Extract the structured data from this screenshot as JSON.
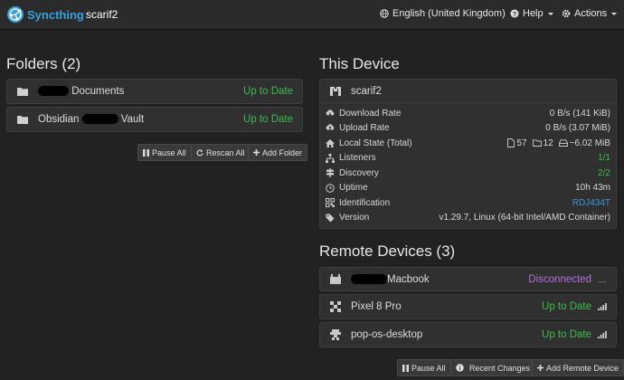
{
  "navbar": {
    "brand": "Syncthing",
    "device_name": "scarif2",
    "language": "English (United Kingdom)",
    "help": "Help",
    "actions": "Actions"
  },
  "folders": {
    "heading": "Folders (2)",
    "items": [
      {
        "name_suffix": "Documents",
        "status": "Up to Date"
      },
      {
        "name_prefix": "Obsidian",
        "name_suffix": "Vault",
        "status": "Up to Date"
      }
    ],
    "buttons": {
      "pause_all": "Pause All",
      "rescan_all": "Rescan All",
      "add_folder": "Add Folder"
    }
  },
  "this_device": {
    "heading": "This Device",
    "name": "scarif2",
    "rows": [
      {
        "label": "Download Rate",
        "value": "0 B/s (141 KiB)"
      },
      {
        "label": "Upload Rate",
        "value": "0 B/s (3.07 MiB)"
      },
      {
        "label": "Local State (Total)",
        "files": "57",
        "dirs": "12",
        "size": "~6.02 MiB"
      },
      {
        "label": "Listeners",
        "value": "1/1"
      },
      {
        "label": "Discovery",
        "value": "2/2"
      },
      {
        "label": "Uptime",
        "value": "10h 43m"
      },
      {
        "label": "Identification",
        "value": "RDJ434T"
      },
      {
        "label": "Version",
        "value": "v1.29.7, Linux (64-bit Intel/AMD Container)"
      }
    ]
  },
  "remote_devices": {
    "heading": "Remote Devices (3)",
    "items": [
      {
        "name": "Macbook",
        "status": "Disconnected"
      },
      {
        "name": "Pixel 8 Pro",
        "status": "Up to Date"
      },
      {
        "name": "pop-os-desktop",
        "status": "Up to Date"
      }
    ],
    "buttons": {
      "pause_all": "Pause All",
      "recent_changes": "Recent Changes",
      "add_remote": "Add Remote Device"
    }
  },
  "colors": {
    "ok": "#3dbb4e",
    "link": "#3b97db",
    "disconnected": "#b16fdc",
    "brand": "#37a2e0"
  }
}
